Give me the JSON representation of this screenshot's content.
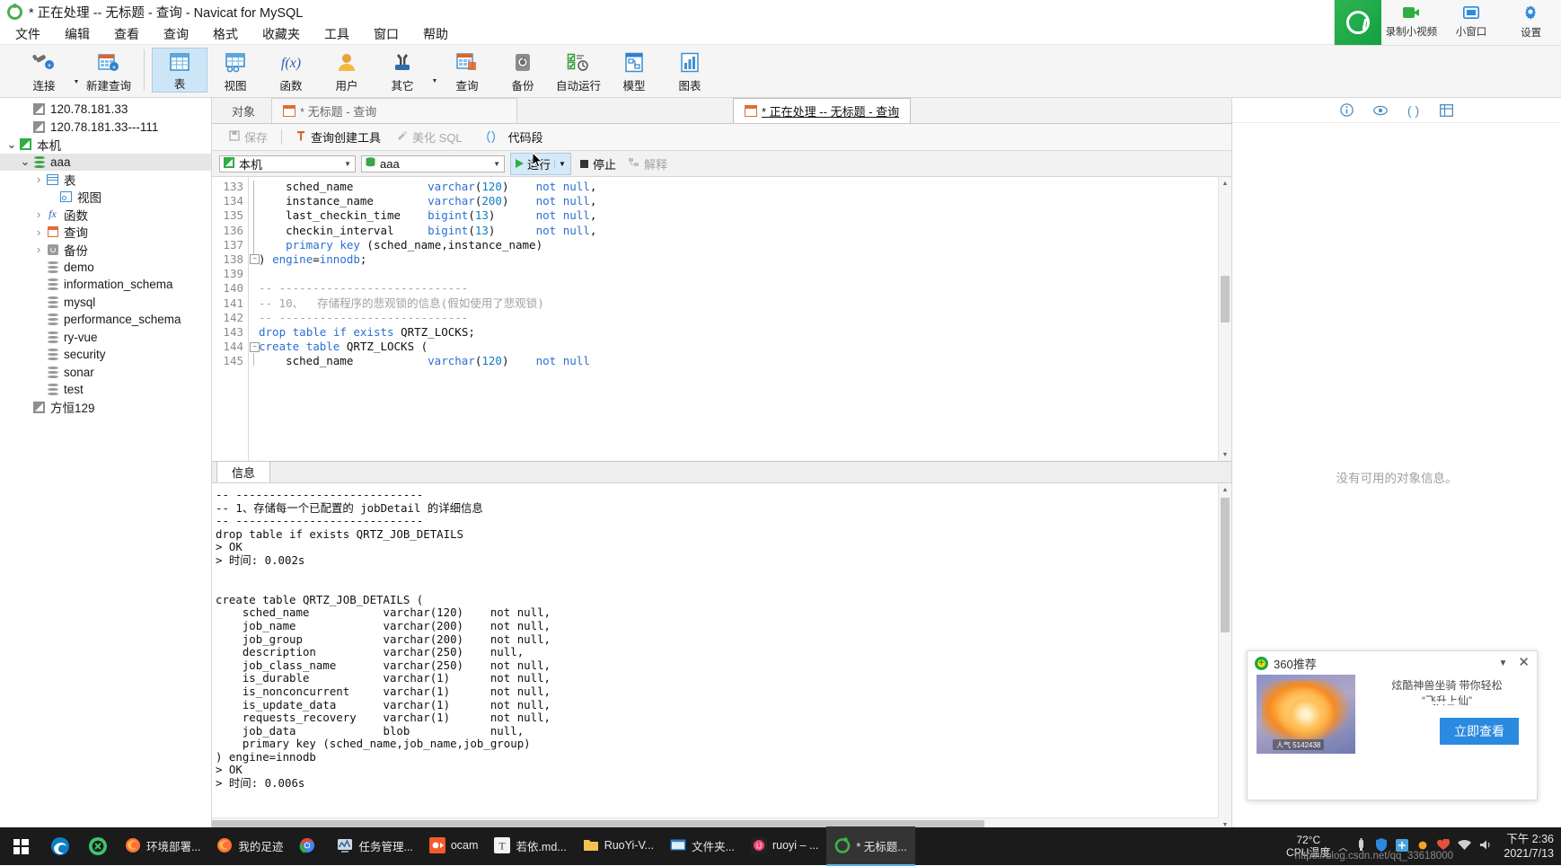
{
  "window": {
    "title": "* 正在处理 -- 无标题 - 查询 - Navicat for MySQL",
    "app_logo_icon": "navicat-logo-icon"
  },
  "menubar": {
    "items": [
      "文件",
      "编辑",
      "查看",
      "查询",
      "格式",
      "收藏夹",
      "工具",
      "窗口",
      "帮助"
    ]
  },
  "ribbon": {
    "groups": [
      {
        "label": "连接",
        "icon": "connection-icon",
        "has_caret": true
      },
      {
        "label": "新建查询",
        "icon": "new-query-icon",
        "has_caret": false
      }
    ],
    "objects": [
      {
        "label": "表",
        "icon": "table-icon",
        "selected": true
      },
      {
        "label": "视图",
        "icon": "view-icon",
        "selected": false
      },
      {
        "label": "函数",
        "icon": "function-icon",
        "selected": false
      },
      {
        "label": "用户",
        "icon": "user-icon",
        "selected": false
      },
      {
        "label": "其它",
        "icon": "other-tools-icon",
        "selected": false,
        "has_caret": true
      },
      {
        "label": "查询",
        "icon": "query-icon",
        "selected": false
      },
      {
        "label": "备份",
        "icon": "backup-icon",
        "selected": false
      },
      {
        "label": "自动运行",
        "icon": "automation-icon",
        "selected": false
      },
      {
        "label": "模型",
        "icon": "model-icon",
        "selected": false
      },
      {
        "label": "图表",
        "icon": "chart-icon",
        "selected": false
      }
    ]
  },
  "sidebar": {
    "nodes": [
      {
        "label": "120.78.181.33",
        "icon": "connection-icon",
        "indent": 1,
        "twisty": "",
        "selected": false
      },
      {
        "label": "120.78.181.33---111",
        "icon": "connection-icon",
        "indent": 1,
        "twisty": "",
        "selected": false
      },
      {
        "label": "本机",
        "icon": "connection-green-icon",
        "indent": 0,
        "twisty": "expanded",
        "selected": false
      },
      {
        "label": "aaa",
        "icon": "database-green-icon",
        "indent": 1,
        "twisty": "expanded",
        "selected": true
      },
      {
        "label": "表",
        "icon": "table-icon",
        "indent": 2,
        "twisty": "collapsed",
        "selected": false
      },
      {
        "label": "视图",
        "icon": "view-icon",
        "indent": 3,
        "twisty": "",
        "selected": false
      },
      {
        "label": "函数",
        "icon": "function-icon",
        "indent": 2,
        "twisty": "collapsed",
        "selected": false
      },
      {
        "label": "查询",
        "icon": "query-icon",
        "indent": 2,
        "twisty": "collapsed",
        "selected": false
      },
      {
        "label": "备份",
        "icon": "backup-icon",
        "indent": 2,
        "twisty": "collapsed",
        "selected": false
      },
      {
        "label": "demo",
        "icon": "database-icon",
        "indent": 2,
        "twisty": "",
        "selected": false
      },
      {
        "label": "information_schema",
        "icon": "database-icon",
        "indent": 2,
        "twisty": "",
        "selected": false
      },
      {
        "label": "mysql",
        "icon": "database-icon",
        "indent": 2,
        "twisty": "",
        "selected": false
      },
      {
        "label": "performance_schema",
        "icon": "database-icon",
        "indent": 2,
        "twisty": "",
        "selected": false
      },
      {
        "label": "ry-vue",
        "icon": "database-icon",
        "indent": 2,
        "twisty": "",
        "selected": false
      },
      {
        "label": "security",
        "icon": "database-icon",
        "indent": 2,
        "twisty": "",
        "selected": false
      },
      {
        "label": "sonar",
        "icon": "database-icon",
        "indent": 2,
        "twisty": "",
        "selected": false
      },
      {
        "label": "test",
        "icon": "database-icon",
        "indent": 2,
        "twisty": "",
        "selected": false
      },
      {
        "label": "方恒129",
        "icon": "connection-icon",
        "indent": 1,
        "twisty": "",
        "selected": false
      }
    ]
  },
  "tabs": {
    "objects_label": "对象",
    "items": [
      {
        "label": "* 无标题 - 查询",
        "active": false
      },
      {
        "label": "* 正在处理 -- 无标题 - 查询",
        "active": true
      }
    ]
  },
  "query_toolbar": {
    "save": "保存",
    "query_builder": "查询创建工具",
    "beautify_sql": "美化 SQL",
    "code_snippet": "代码段"
  },
  "runbar": {
    "connection_value": "本机",
    "database_value": "aaa",
    "run_label": "运行",
    "stop_label": "停止",
    "explain_label": "解释"
  },
  "editor": {
    "first_line_number": 133,
    "lines": [
      {
        "n": 133,
        "text": "    sched_name           varchar(120)    not null,"
      },
      {
        "n": 134,
        "text": "    instance_name        varchar(200)    not null,"
      },
      {
        "n": 135,
        "text": "    last_checkin_time    bigint(13)      not null,"
      },
      {
        "n": 136,
        "text": "    checkin_interval     bigint(13)      not null,"
      },
      {
        "n": 137,
        "text": "    primary key (sched_name,instance_name)"
      },
      {
        "n": 138,
        "text": ") engine=innodb;"
      },
      {
        "n": 139,
        "text": ""
      },
      {
        "n": 140,
        "text": "-- ----------------------------"
      },
      {
        "n": 141,
        "text": "-- 10、  存储程序的悲观锁的信息(假如使用了悲观锁)"
      },
      {
        "n": 142,
        "text": "-- ----------------------------"
      },
      {
        "n": 143,
        "text": "drop table if exists QRTZ_LOCKS;"
      },
      {
        "n": 144,
        "text": "create table QRTZ_LOCKS ("
      },
      {
        "n": 145,
        "text": "    sched_name           varchar(120)    not null"
      }
    ]
  },
  "result": {
    "tab_label": "信息",
    "log": "-- ----------------------------\n-- 1、存储每一个已配置的 jobDetail 的详细信息\n-- ----------------------------\ndrop table if exists QRTZ_JOB_DETAILS\n> OK\n> 时间: 0.002s\n\n\ncreate table QRTZ_JOB_DETAILS (\n    sched_name           varchar(120)    not null,\n    job_name             varchar(200)    not null,\n    job_group            varchar(200)    not null,\n    description          varchar(250)    null,\n    job_class_name       varchar(250)    not null,\n    is_durable           varchar(1)      not null,\n    is_nonconcurrent     varchar(1)      not null,\n    is_update_data       varchar(1)      not null,\n    requests_recovery    varchar(1)      not null,\n    job_data             blob            null,\n    primary key (sched_name,job_name,job_group)\n) engine=innodb\n> OK\n> 时间: 0.006s"
  },
  "right_panel": {
    "tools": [
      {
        "icon": "info-icon"
      },
      {
        "icon": "eye-icon"
      },
      {
        "icon": "parentheses-icon"
      },
      {
        "icon": "grid-icon"
      }
    ],
    "empty_message": "没有可用的对象信息。"
  },
  "float_toolbar": {
    "logo_icon": "360-browser-icon",
    "items": [
      {
        "label": "录制小视频",
        "icon": "video-record-icon"
      },
      {
        "label": "小窗口",
        "icon": "mini-window-icon"
      },
      {
        "label": "设置",
        "icon": "gear-icon"
      }
    ]
  },
  "ad": {
    "title": "360推荐",
    "logo_icon": "360-logo-icon",
    "collapse_icon": "chevron-down-icon",
    "close_icon": "close-icon",
    "description_line1": "炫酷神兽坐骑 带你轻松",
    "description_line2": "“飞升上仙”",
    "thumb_tag": "人气 5142438",
    "play_icon": "play-icon",
    "cta_label": "立即查看"
  },
  "taskbar": {
    "start_icon": "windows-start-icon",
    "pinned": [
      {
        "icon": "edge-icon"
      },
      {
        "icon": "360-browser-icon"
      }
    ],
    "tasks": [
      {
        "label": "环境部署...",
        "icon": "firefox-icon",
        "active": false
      },
      {
        "label": "我的足迹",
        "icon": "firefox-icon",
        "active": false
      },
      {
        "label": "",
        "icon": "chrome-icon",
        "active": false
      },
      {
        "label": "任务管理...",
        "icon": "task-manager-icon",
        "active": false
      },
      {
        "label": "ocam",
        "icon": "ocam-icon",
        "active": false
      },
      {
        "label": "若依.md...",
        "icon": "typora-icon",
        "active": false
      },
      {
        "label": "RuoYi-V...",
        "icon": "folder-icon",
        "active": false
      },
      {
        "label": "文件夹...",
        "icon": "folder-window-icon",
        "active": false
      },
      {
        "label": "ruoyi – ...",
        "icon": "idea-icon",
        "active": false
      },
      {
        "label": "* 无标题...",
        "icon": "navicat-icon",
        "active": true
      }
    ],
    "temperature": "72°C",
    "temperature_label": "CPU温度",
    "tray_icons": [
      {
        "icon": "chevron-up-icon"
      },
      {
        "icon": "usb-icon"
      },
      {
        "icon": "shield-icon"
      },
      {
        "icon": "box-icon"
      },
      {
        "icon": "sun-icon"
      },
      {
        "icon": "heart-icon"
      },
      {
        "icon": "network-icon"
      },
      {
        "icon": "volume-icon"
      }
    ],
    "clock_time": "下午 2:36",
    "clock_date": "2021/7/13"
  },
  "watermark": "https://blog.csdn.net/qq_33618000"
}
